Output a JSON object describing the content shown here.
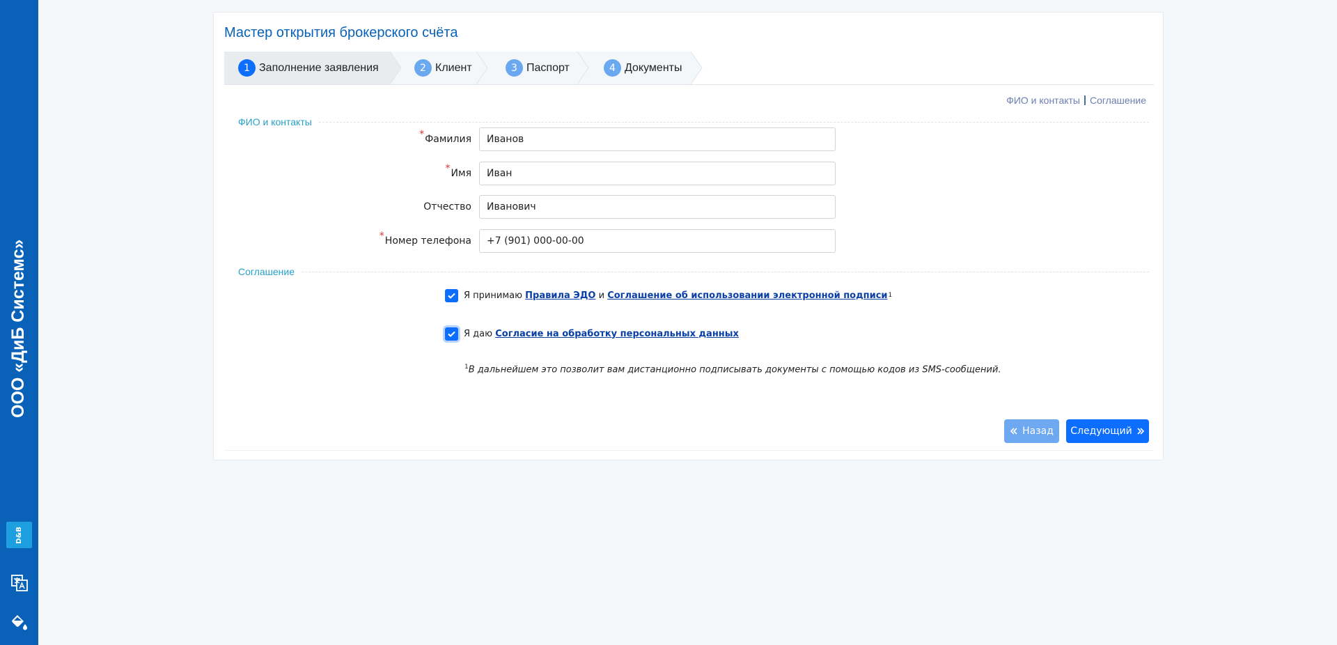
{
  "sidebar": {
    "brand_text": "ООО «ДиБ Системс»",
    "logo_text": "D&B",
    "icons": [
      "translate-icon",
      "paint-bucket-icon"
    ]
  },
  "wizard": {
    "title": "Мастер открытия брокерского счёта",
    "steps": [
      {
        "num": "1",
        "label": "Заполнение заявления",
        "active": true
      },
      {
        "num": "2",
        "label": "Клиент",
        "active": false
      },
      {
        "num": "3",
        "label": "Паспорт",
        "active": false
      },
      {
        "num": "4",
        "label": "Документы",
        "active": false
      }
    ],
    "section_links": {
      "contacts": "ФИО и контакты",
      "agreement": "Соглашение"
    }
  },
  "contacts_section": {
    "legend": "ФИО и контакты",
    "fields": {
      "surname": {
        "label": "Фамилия",
        "value": "Иванов",
        "required": true
      },
      "name": {
        "label": "Имя",
        "value": "Иван",
        "required": true
      },
      "patronymic": {
        "label": "Отчество",
        "value": "Иванович",
        "required": false
      },
      "phone": {
        "label": "Номер телефона",
        "value": "+7 (901) 000-00-00",
        "required": true
      }
    }
  },
  "agreement_section": {
    "legend": "Соглашение",
    "check1": {
      "prefix": "Я принимаю",
      "link1": "Правила ЭДО",
      "conj": "и",
      "link2": "Соглашение об использовании электронной подписи",
      "sup": "1",
      "checked": true
    },
    "check2": {
      "prefix": "Я даю",
      "link": "Согласие на обработку персональных данных",
      "checked": true
    },
    "footnote_mark": "1",
    "footnote": "В дальнейшем это позволит вам дистанционно подписывать документы с помощью кодов из SMS-сообщений."
  },
  "buttons": {
    "back": "Назад",
    "next": "Следующий"
  },
  "colors": {
    "primary": "#0d6efd",
    "sidebar": "#0962b7",
    "legend": "#27a0c9",
    "required": "#e03131"
  }
}
